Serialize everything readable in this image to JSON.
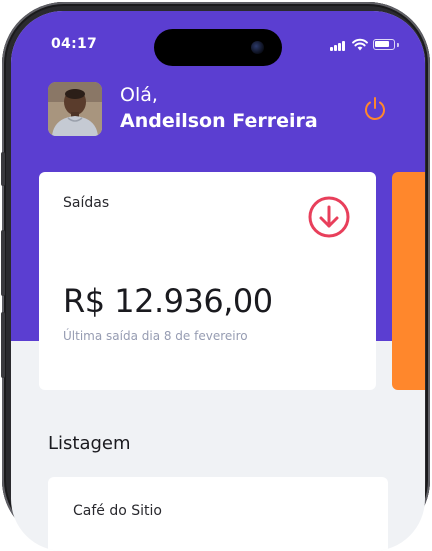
{
  "status_bar": {
    "time": "04:17"
  },
  "header": {
    "greeting": "Olá,",
    "user_name": "Andeilson Ferreira"
  },
  "summary_card": {
    "title": "Saídas",
    "amount": "R$ 12.936,00",
    "subtitle": "Última saída dia 8 de fevereiro",
    "icon": "arrow-down-circle-icon",
    "icon_color": "#e83f5b"
  },
  "colors": {
    "primary": "#5b3ed1",
    "power_icon": "#ff872c",
    "next_card_accent": "#ff872c",
    "background": "#f0f2f5"
  },
  "listing": {
    "title": "Listagem",
    "items": [
      {
        "title": "Café do Sitio"
      }
    ]
  }
}
